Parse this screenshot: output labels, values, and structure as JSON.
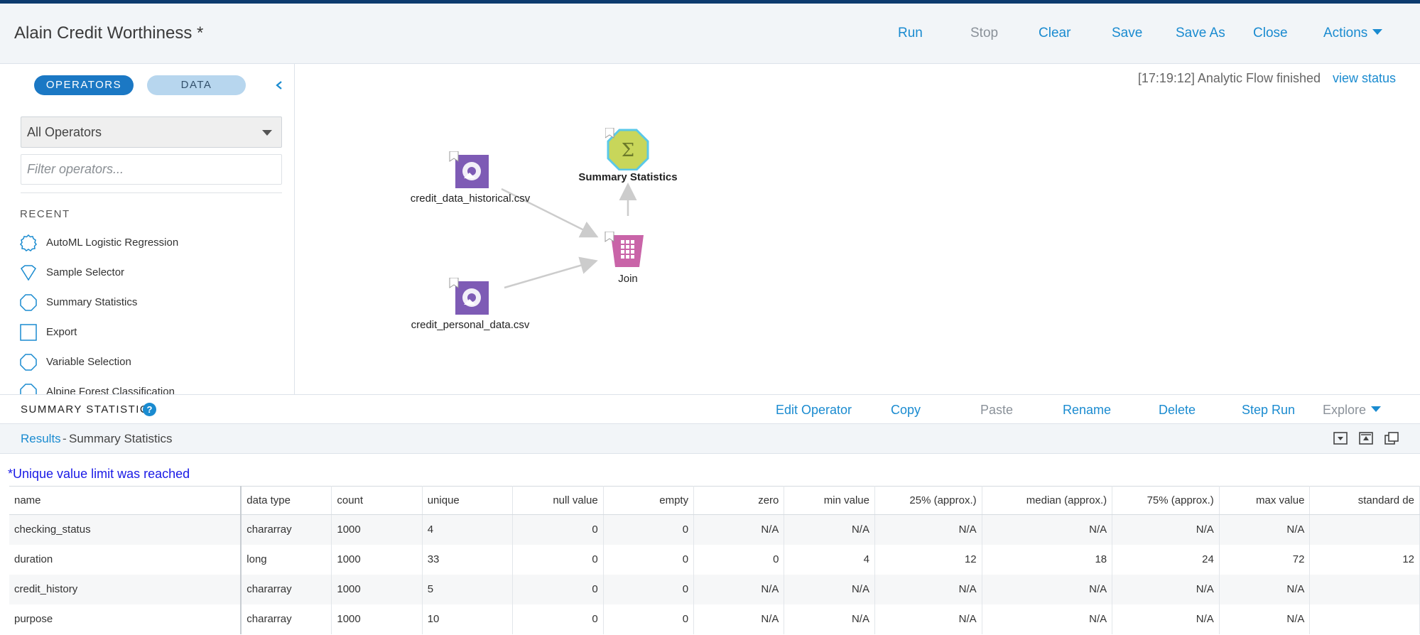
{
  "header": {
    "title": "Alain Credit Worthiness *",
    "actions": [
      {
        "label": "Run"
      },
      {
        "label": "Stop"
      },
      {
        "label": "Clear"
      },
      {
        "label": "Save"
      },
      {
        "label": "Save As"
      },
      {
        "label": "Close"
      },
      {
        "label": "Actions"
      }
    ]
  },
  "sidebar": {
    "tab_operators": "OPERATORS",
    "tab_data": "DATA",
    "select_value": "All Operators",
    "filter_placeholder": "Filter operators...",
    "recent_label": "RECENT",
    "recent_items": [
      {
        "label": "AutoML Logistic Regression",
        "icon": "gear-outline-icon"
      },
      {
        "label": "Sample Selector",
        "icon": "diamond-outline-icon"
      },
      {
        "label": "Summary Statistics",
        "icon": "hexagon-outline-icon"
      },
      {
        "label": "Export",
        "icon": "square-outline-icon"
      },
      {
        "label": "Variable Selection",
        "icon": "hexagon-outline-icon"
      },
      {
        "label": "Alpine Forest Classification",
        "icon": "hexagon-outline-icon"
      }
    ]
  },
  "canvas": {
    "status_text": "[17:19:12] Analytic Flow finished",
    "view_status": "view status",
    "nodes": {
      "historical": "credit_data_historical.csv",
      "personal": "credit_personal_data.csv",
      "join": "Join",
      "summary": "Summary Statistics"
    }
  },
  "panel": {
    "title": "SUMMARY STATISTICS",
    "help": "?",
    "actions": [
      {
        "label": "Edit Operator"
      },
      {
        "label": "Copy"
      },
      {
        "label": "Paste"
      },
      {
        "label": "Rename"
      },
      {
        "label": "Delete"
      },
      {
        "label": "Step Run"
      },
      {
        "label": "Explore"
      }
    ]
  },
  "results": {
    "link": "Results",
    "separator": "-",
    "name": "Summary Statistics",
    "notice": "*Unique value limit was reached",
    "columns": [
      "name",
      "data type",
      "count",
      "unique",
      "null value",
      "empty",
      "zero",
      "min value",
      "25% (approx.)",
      "median (approx.)",
      "75% (approx.)",
      "max value",
      "standard de"
    ],
    "rows": [
      [
        "checking_status",
        "chararray",
        "1000",
        "4",
        "0",
        "0",
        "N/A",
        "N/A",
        "N/A",
        "N/A",
        "N/A",
        "N/A",
        ""
      ],
      [
        "duration",
        "long",
        "1000",
        "33",
        "0",
        "0",
        "0",
        "4",
        "12",
        "18",
        "24",
        "72",
        "12"
      ],
      [
        "credit_history",
        "chararray",
        "1000",
        "5",
        "0",
        "0",
        "N/A",
        "N/A",
        "N/A",
        "N/A",
        "N/A",
        "N/A",
        ""
      ],
      [
        "purpose",
        "chararray",
        "1000",
        "10",
        "0",
        "0",
        "N/A",
        "N/A",
        "N/A",
        "N/A",
        "N/A",
        "N/A",
        ""
      ]
    ]
  },
  "colors": {
    "accent": "#1a8bd0",
    "topbar": "#0d3b6e",
    "dataset_node": "#7e5bb5",
    "join_node": "#c964a8",
    "summary_node": "#c8d65a"
  }
}
